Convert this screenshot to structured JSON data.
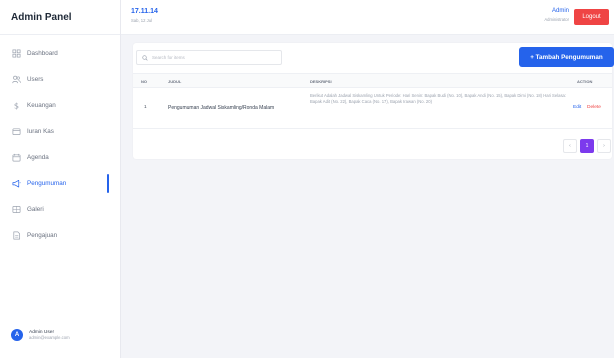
{
  "brand": "Admin Panel",
  "nav": [
    {
      "label": "Dashboard",
      "icon": "grid-icon"
    },
    {
      "label": "Users",
      "icon": "users-icon"
    },
    {
      "label": "Keuangan",
      "icon": "dollar-icon"
    },
    {
      "label": "Iuran Kas",
      "icon": "wallet-icon"
    },
    {
      "label": "Agenda",
      "icon": "calendar-icon"
    },
    {
      "label": "Pengumuman",
      "icon": "megaphone-icon",
      "active": true
    },
    {
      "label": "Galeri",
      "icon": "image-icon"
    },
    {
      "label": "Pengajuan",
      "icon": "document-icon"
    }
  ],
  "user": {
    "initial": "A",
    "name": "Admin User",
    "email": "admin@example.com"
  },
  "topbar": {
    "time": "17.11.14",
    "date": "Sab, 12 Jul",
    "admin_name": "Admin",
    "admin_role": "Administrator",
    "logout_label": "Logout"
  },
  "toolbar": {
    "search_placeholder": "Search for items",
    "add_label": "+ Tambah Pengumuman"
  },
  "table": {
    "columns": {
      "no": "NO",
      "title": "JUDUL",
      "desc": "DESKRIPSI",
      "action": "ACTION"
    },
    "rows": [
      {
        "no": "1",
        "title": "Pengumuman Jadwal Siskamling/Ronda Malam",
        "desc": "Berikut Adalah Jadwal Siskamling Untuk Periode: Hari Senin: Bapak Budi (No. 10), Bapak Andi (No. 15), Bapak Dimi (No. 18) Hari Selasa: Bapak Adit (No. 22), Bapak Caca (No. 17), Bapak Irawan (No. 20)",
        "edit": "Edit",
        "delete": "Delete"
      }
    ]
  },
  "pagination": {
    "prev": "‹",
    "current": "1",
    "next": "›"
  },
  "colors": {
    "primary": "#2563eb",
    "danger": "#ef4444",
    "page_active": "#7c3aed"
  }
}
